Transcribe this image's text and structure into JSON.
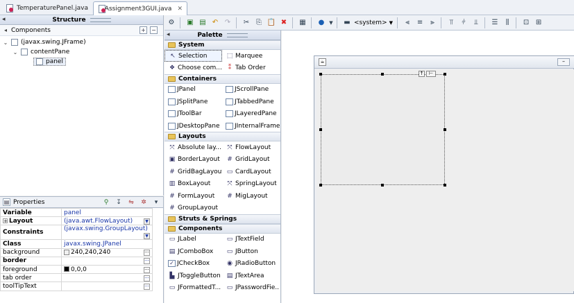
{
  "tabs": [
    {
      "label": "TemperaturePanel.java",
      "active": false
    },
    {
      "label": "*Assignment3GUI.java",
      "active": true
    }
  ],
  "structure": {
    "title": "Structure",
    "components_label": "Components",
    "tree": [
      {
        "label": "(javax.swing.JFrame)",
        "level": 0
      },
      {
        "label": "contentPane",
        "level": 1
      },
      {
        "label": "panel",
        "level": 2
      }
    ]
  },
  "properties": {
    "title": "Properties",
    "rows": [
      {
        "name": "Variable",
        "value": "panel"
      },
      {
        "name": "Layout",
        "value": "(java.awt.FlowLayout)"
      },
      {
        "name": "Constraints",
        "value": "(javax.swing.GroupLayout)"
      },
      {
        "name": "Class",
        "value": "javax.swing.JPanel"
      },
      {
        "name": "background",
        "value": "240,240,240"
      },
      {
        "name": "border",
        "value": ""
      },
      {
        "name": "foreground",
        "value": "0,0,0"
      },
      {
        "name": "tab order",
        "value": ""
      },
      {
        "name": "toolTipText",
        "value": ""
      }
    ]
  },
  "toolbar": {
    "laf_label": "<system>"
  },
  "palette": {
    "title": "Palette",
    "categories": [
      {
        "name": "System",
        "items": [
          "Selection",
          "Marquee",
          "Choose com...",
          "Tab Order"
        ]
      },
      {
        "name": "Containers",
        "items": [
          "JPanel",
          "JScrollPane",
          "JSplitPane",
          "JTabbedPane",
          "JToolBar",
          "JLayeredPane",
          "JDesktopPane",
          "JInternalFrame"
        ]
      },
      {
        "name": "Layouts",
        "items": [
          "Absolute lay...",
          "FlowLayout",
          "BorderLayout",
          "GridLayout",
          "GridBagLayout",
          "CardLayout",
          "BoxLayout",
          "SpringLayout",
          "FormLayout",
          "MigLayout",
          "GroupLayout"
        ]
      },
      {
        "name": "Struts & Springs",
        "items": []
      },
      {
        "name": "Components",
        "items": [
          "JLabel",
          "JTextField",
          "JComboBox",
          "JButton",
          "JCheckBox",
          "JRadioButton",
          "JToggleButton",
          "JTextArea",
          "JFormattedT...",
          "JPasswordFie..."
        ]
      }
    ]
  },
  "colors": {
    "accent": "#1a37a8",
    "background_swatch": "#f0f0f0",
    "foreground_swatch": "#000000"
  }
}
